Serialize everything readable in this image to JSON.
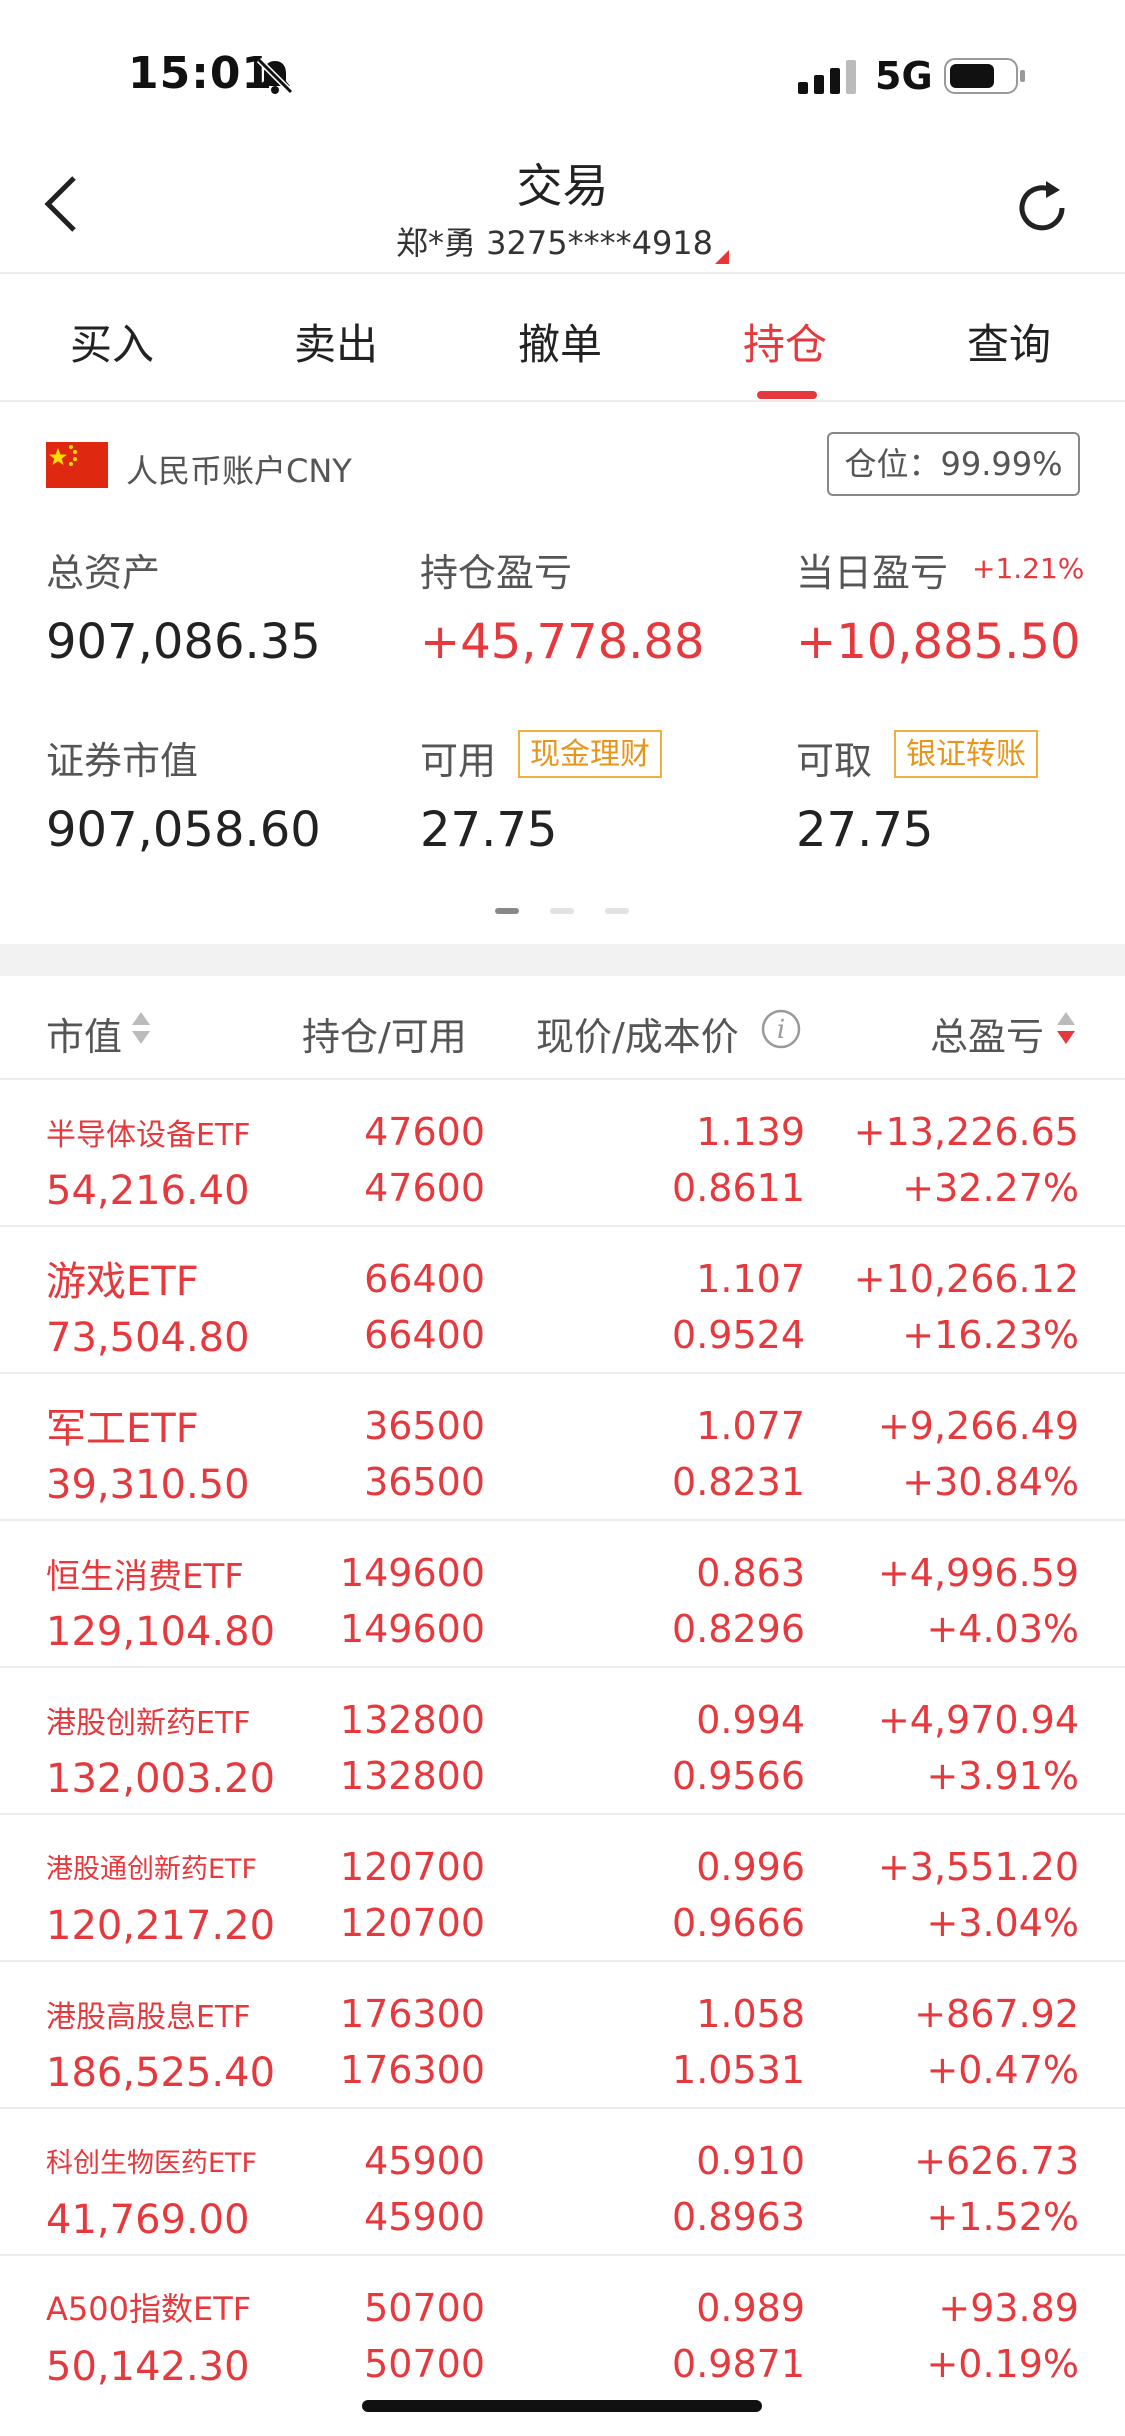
{
  "status": {
    "time": "15:01",
    "network": "5G"
  },
  "nav": {
    "title": "交易",
    "account": "郑*勇 3275****4918"
  },
  "tabs": [
    {
      "label": "买入"
    },
    {
      "label": "卖出"
    },
    {
      "label": "撤单"
    },
    {
      "label": "持仓",
      "active": true
    },
    {
      "label": "查询"
    }
  ],
  "account": {
    "currency_label": "人民币账户CNY",
    "position_ratio": "仓位：99.99%",
    "total_assets_label": "总资产",
    "total_assets": "907,086.35",
    "holding_pl_label": "持仓盈亏",
    "holding_pl": "+45,778.88",
    "daily_pl_label": "当日盈亏",
    "daily_pl_pct": "+1.21%",
    "daily_pl": "+10,885.50",
    "market_value_label": "证券市值",
    "market_value": "907,058.60",
    "available_label": "可用",
    "cash_mgmt_tag": "现金理财",
    "available": "27.75",
    "withdrawable_label": "可取",
    "bank_transfer_tag": "银证转账",
    "withdrawable": "27.75"
  },
  "table": {
    "headers": {
      "market_value": "市值",
      "holding": "持仓/可用",
      "price": "现价/成本价",
      "total_pl": "总盈亏"
    },
    "rows": [
      {
        "name": "半导体设备ETF",
        "market_value": "54,216.40",
        "holding": "47600",
        "available": "47600",
        "price": "1.139",
        "cost": "0.8611",
        "pl": "+13,226.65",
        "pl_pct": "+32.27%"
      },
      {
        "name": "游戏ETF",
        "market_value": "73,504.80",
        "holding": "66400",
        "available": "66400",
        "price": "1.107",
        "cost": "0.9524",
        "pl": "+10,266.12",
        "pl_pct": "+16.23%"
      },
      {
        "name": "军工ETF",
        "market_value": "39,310.50",
        "holding": "36500",
        "available": "36500",
        "price": "1.077",
        "cost": "0.8231",
        "pl": "+9,266.49",
        "pl_pct": "+30.84%"
      },
      {
        "name": "恒生消费ETF",
        "market_value": "129,104.80",
        "holding": "149600",
        "available": "149600",
        "price": "0.863",
        "cost": "0.8296",
        "pl": "+4,996.59",
        "pl_pct": "+4.03%"
      },
      {
        "name": "港股创新药ETF",
        "market_value": "132,003.20",
        "holding": "132800",
        "available": "132800",
        "price": "0.994",
        "cost": "0.9566",
        "pl": "+4,970.94",
        "pl_pct": "+3.91%"
      },
      {
        "name": "港股通创新药ETF",
        "market_value": "120,217.20",
        "holding": "120700",
        "available": "120700",
        "price": "0.996",
        "cost": "0.9666",
        "pl": "+3,551.20",
        "pl_pct": "+3.04%"
      },
      {
        "name": "港股高股息ETF",
        "market_value": "186,525.40",
        "holding": "176300",
        "available": "176300",
        "price": "1.058",
        "cost": "1.0531",
        "pl": "+867.92",
        "pl_pct": "+0.47%"
      },
      {
        "name": "科创生物医药ETF",
        "market_value": "41,769.00",
        "holding": "45900",
        "available": "45900",
        "price": "0.910",
        "cost": "0.8963",
        "pl": "+626.73",
        "pl_pct": "+1.52%"
      },
      {
        "name": "A500指数ETF",
        "market_value": "50,142.30",
        "holding": "50700",
        "available": "50700",
        "price": "0.989",
        "cost": "0.9871",
        "pl": "+93.89",
        "pl_pct": "+0.19%"
      }
    ]
  },
  "colors": {
    "accent": "#e5393d",
    "tag": "#e8961b",
    "flag": "#de2910"
  }
}
